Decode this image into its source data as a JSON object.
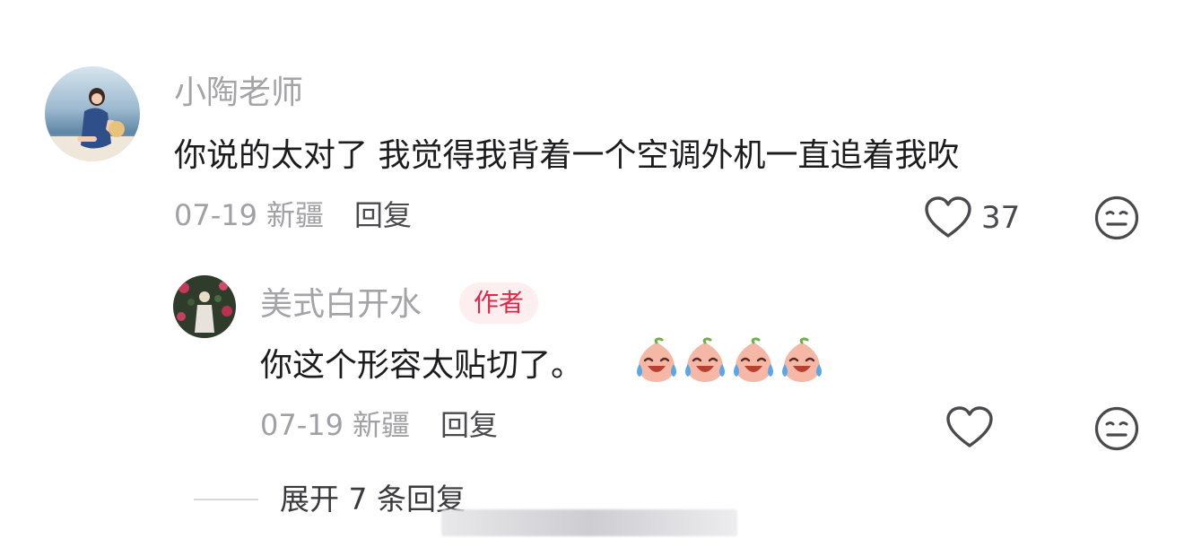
{
  "comment": {
    "username": "小陶老师",
    "text": "你说的太对了  我觉得我背着一个空调外机一直追着我吹",
    "date": "07-19",
    "location": "新疆",
    "reply_label": "回复",
    "like_count": "37",
    "like_icon": "heart-outline-icon",
    "dislike_icon": "meh-face-icon"
  },
  "reply": {
    "username": "美式白开水",
    "badge": "作者",
    "text": "你这个形容太贴切了。",
    "emoji_icon": "crying-laughing-peach-emoji",
    "emoji_count": 4,
    "date": "07-19",
    "location": "新疆",
    "reply_label": "回复",
    "like_icon": "heart-outline-icon",
    "dislike_icon": "meh-face-icon"
  },
  "expand": {
    "label": "展开 7 条回复"
  },
  "colors": {
    "badge_bg": "#fdeef0",
    "badge_text": "#e0294a",
    "meta_gray": "#a0a0a5"
  }
}
